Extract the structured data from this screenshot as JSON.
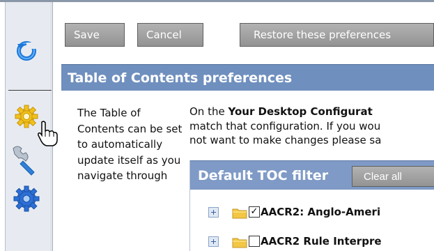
{
  "toolbar": {
    "save_label": "Save",
    "cancel_label": "Cancel",
    "restore_label": "Restore these preferences"
  },
  "panel": {
    "title": "Table of Contents preferences",
    "description": "The Table of Contents can be set to automatically update itself as you navigate through",
    "intro_prefix": "On the ",
    "intro_bold": "Your Desktop Configurat",
    "intro_line2": "match that configuration. If you wou",
    "intro_line3": "not want to make changes please sa"
  },
  "toc": {
    "header": "Default TOC filter",
    "clear_label": "Clear all",
    "items": [
      {
        "label": "AACR2: Anglo-Ameri",
        "checked": true,
        "check_glyph": "✓"
      },
      {
        "label": "AACR2 Rule Interpre",
        "checked": false,
        "check_glyph": ""
      }
    ]
  },
  "sidebar": {
    "icons": [
      "refresh-icon",
      "gear-icon",
      "wrench-icon",
      "blue-gear-icon"
    ]
  },
  "colors": {
    "title_bar": "#6f8fbe",
    "button": "#a3a3a3",
    "sidebar": "#e7ebf1"
  }
}
